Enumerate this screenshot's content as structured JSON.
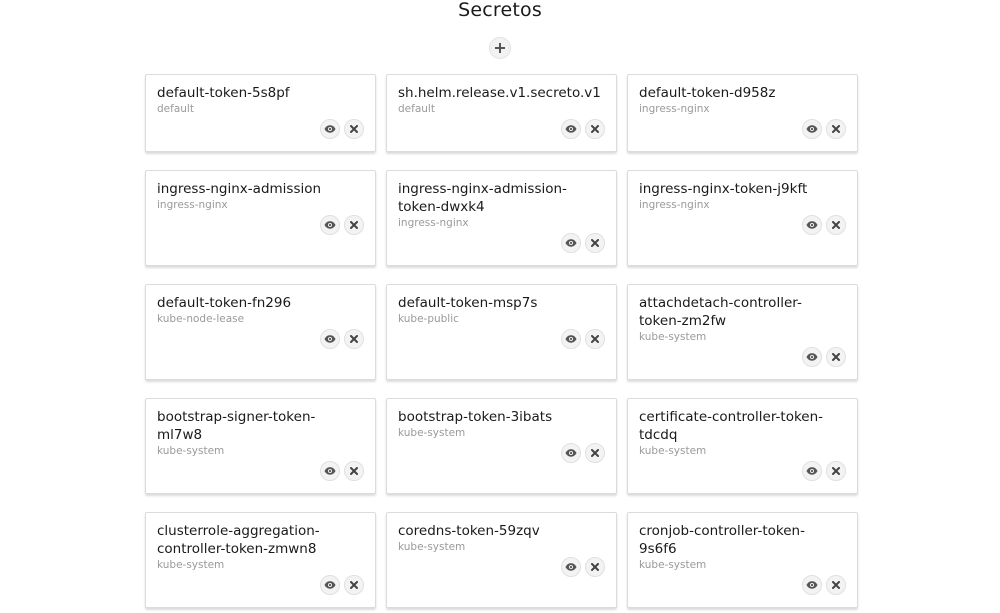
{
  "page": {
    "title": "Secretos",
    "add_icon": "plus-icon"
  },
  "secrets": [
    {
      "name": "default-token-5s8pf",
      "namespace": "default"
    },
    {
      "name": "sh.helm.release.v1.secreto.v1",
      "namespace": "default"
    },
    {
      "name": "default-token-d958z",
      "namespace": "ingress-nginx"
    },
    {
      "name": "ingress-nginx-admission",
      "namespace": "ingress-nginx"
    },
    {
      "name": "ingress-nginx-admission-token-dwxk4",
      "namespace": "ingress-nginx"
    },
    {
      "name": "ingress-nginx-token-j9kft",
      "namespace": "ingress-nginx"
    },
    {
      "name": "default-token-fn296",
      "namespace": "kube-node-lease"
    },
    {
      "name": "default-token-msp7s",
      "namespace": "kube-public"
    },
    {
      "name": "attachdetach-controller-token-zm2fw",
      "namespace": "kube-system"
    },
    {
      "name": "bootstrap-signer-token-ml7w8",
      "namespace": "kube-system"
    },
    {
      "name": "bootstrap-token-3ibats",
      "namespace": "kube-system"
    },
    {
      "name": "certificate-controller-token-tdcdq",
      "namespace": "kube-system"
    },
    {
      "name": "clusterrole-aggregation-controller-token-zmwn8",
      "namespace": "kube-system"
    },
    {
      "name": "coredns-token-59zqv",
      "namespace": "kube-system"
    },
    {
      "name": "cronjob-controller-token-9s6f6",
      "namespace": "kube-system"
    }
  ],
  "icons": {
    "view": "eye-icon",
    "delete": "close-icon"
  }
}
